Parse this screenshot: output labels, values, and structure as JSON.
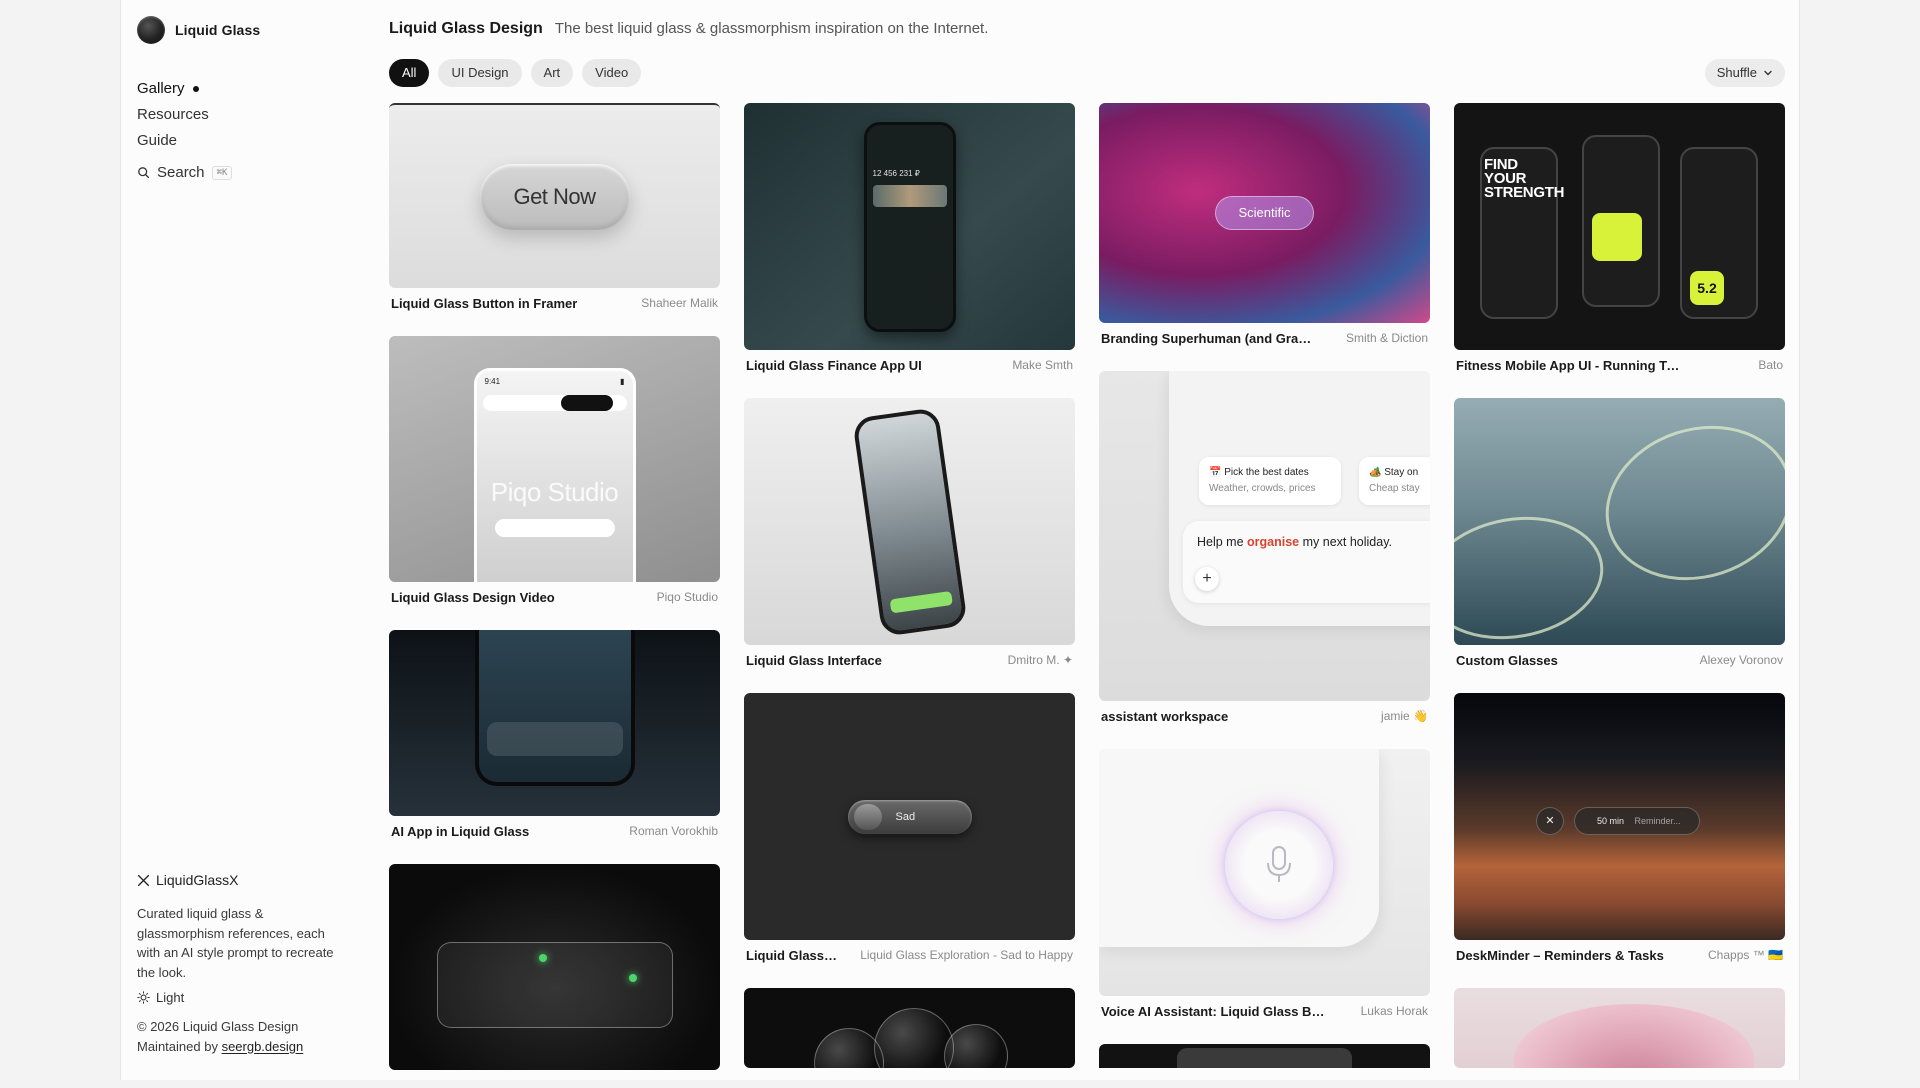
{
  "brand": {
    "name": "Liquid Glass"
  },
  "nav": [
    {
      "label": "Gallery",
      "active": true
    },
    {
      "label": "Resources"
    },
    {
      "label": "Guide"
    }
  ],
  "search": {
    "label": "Search",
    "shortcut": "⌘K"
  },
  "footer": {
    "x_handle": "LiquidGlassX",
    "about": "Curated liquid glass & glassmorphism references, each with an AI style prompt to recreate the look.",
    "theme_label": "Light",
    "copyright": "© 2026 Liquid Glass Design",
    "maintained_prefix": "Maintained by ",
    "maintained_link": "seergb.design"
  },
  "header": {
    "title": "Liquid Glass Design",
    "tagline": "The best liquid glass & glassmorphism inspiration on the Internet."
  },
  "filters": [
    "All",
    "UI Design",
    "Art",
    "Video"
  ],
  "active_filter": "All",
  "sort": {
    "label": "Shuffle"
  },
  "thumb_text": {
    "get_now": "Get Now",
    "piqo": "Piqo Studio",
    "piqo_time": "9:41",
    "finance_amount": "12 456 231 ₽",
    "sad": "Sad",
    "scientific": "Scientific",
    "assist_box1_title": "📅 Pick the best dates",
    "assist_box1_sub": "Weather, crowds, prices",
    "assist_box2_title": "🏕️ Stay on",
    "assist_box2_sub": "Cheap stay",
    "assist_prompt_a": "Help me ",
    "assist_prompt_hl": "organise",
    "assist_prompt_b": " my next holiday.",
    "fitness_big": "FIND YOUR STRENGTH",
    "fitness_num": "5.2",
    "desk_time": "50 min",
    "desk_hint": "Reminder..."
  },
  "cards": {
    "c1": {
      "title": "Liquid Glass Button in Framer",
      "author": "Shaheer Malik"
    },
    "c2": {
      "title": "Liquid Glass Design Video",
      "author": "Piqo Studio"
    },
    "c3": {
      "title": "AI App in Liquid Glass",
      "author": "Roman Vorokhib"
    },
    "c4": {
      "title": "Liquid Glass Finance App UI",
      "author": "Make Smth"
    },
    "c5": {
      "title": "Liquid Glass Interface",
      "author": "Dmitro M. ✦"
    },
    "c6": {
      "title": "Liquid Glass Exploration - Sad to Happy",
      "author": "Liquid Glass Exploration - Sad to Happy"
    },
    "c7": {
      "title": "Branding Superhuman (and Grammarly)",
      "author": "Smith & Diction"
    },
    "c8": {
      "title": "assistant workspace",
      "author": "jamie 👋"
    },
    "c9": {
      "title": "Voice AI Assistant: Liquid Glass Button",
      "author": "Lukas Horak"
    },
    "c10": {
      "title": "Fitness Mobile App UI - Running Tracker",
      "author": "Bato"
    },
    "c11": {
      "title": "Custom Glasses",
      "author": "Alexey Voronov"
    },
    "c12": {
      "title": "DeskMinder – Reminders & Tasks",
      "author": "Chapps ™ 🇺🇦"
    }
  },
  "colors": {
    "accent": "#111111",
    "chip_bg": "#e9e9e9",
    "highlight": "#d9442f"
  }
}
